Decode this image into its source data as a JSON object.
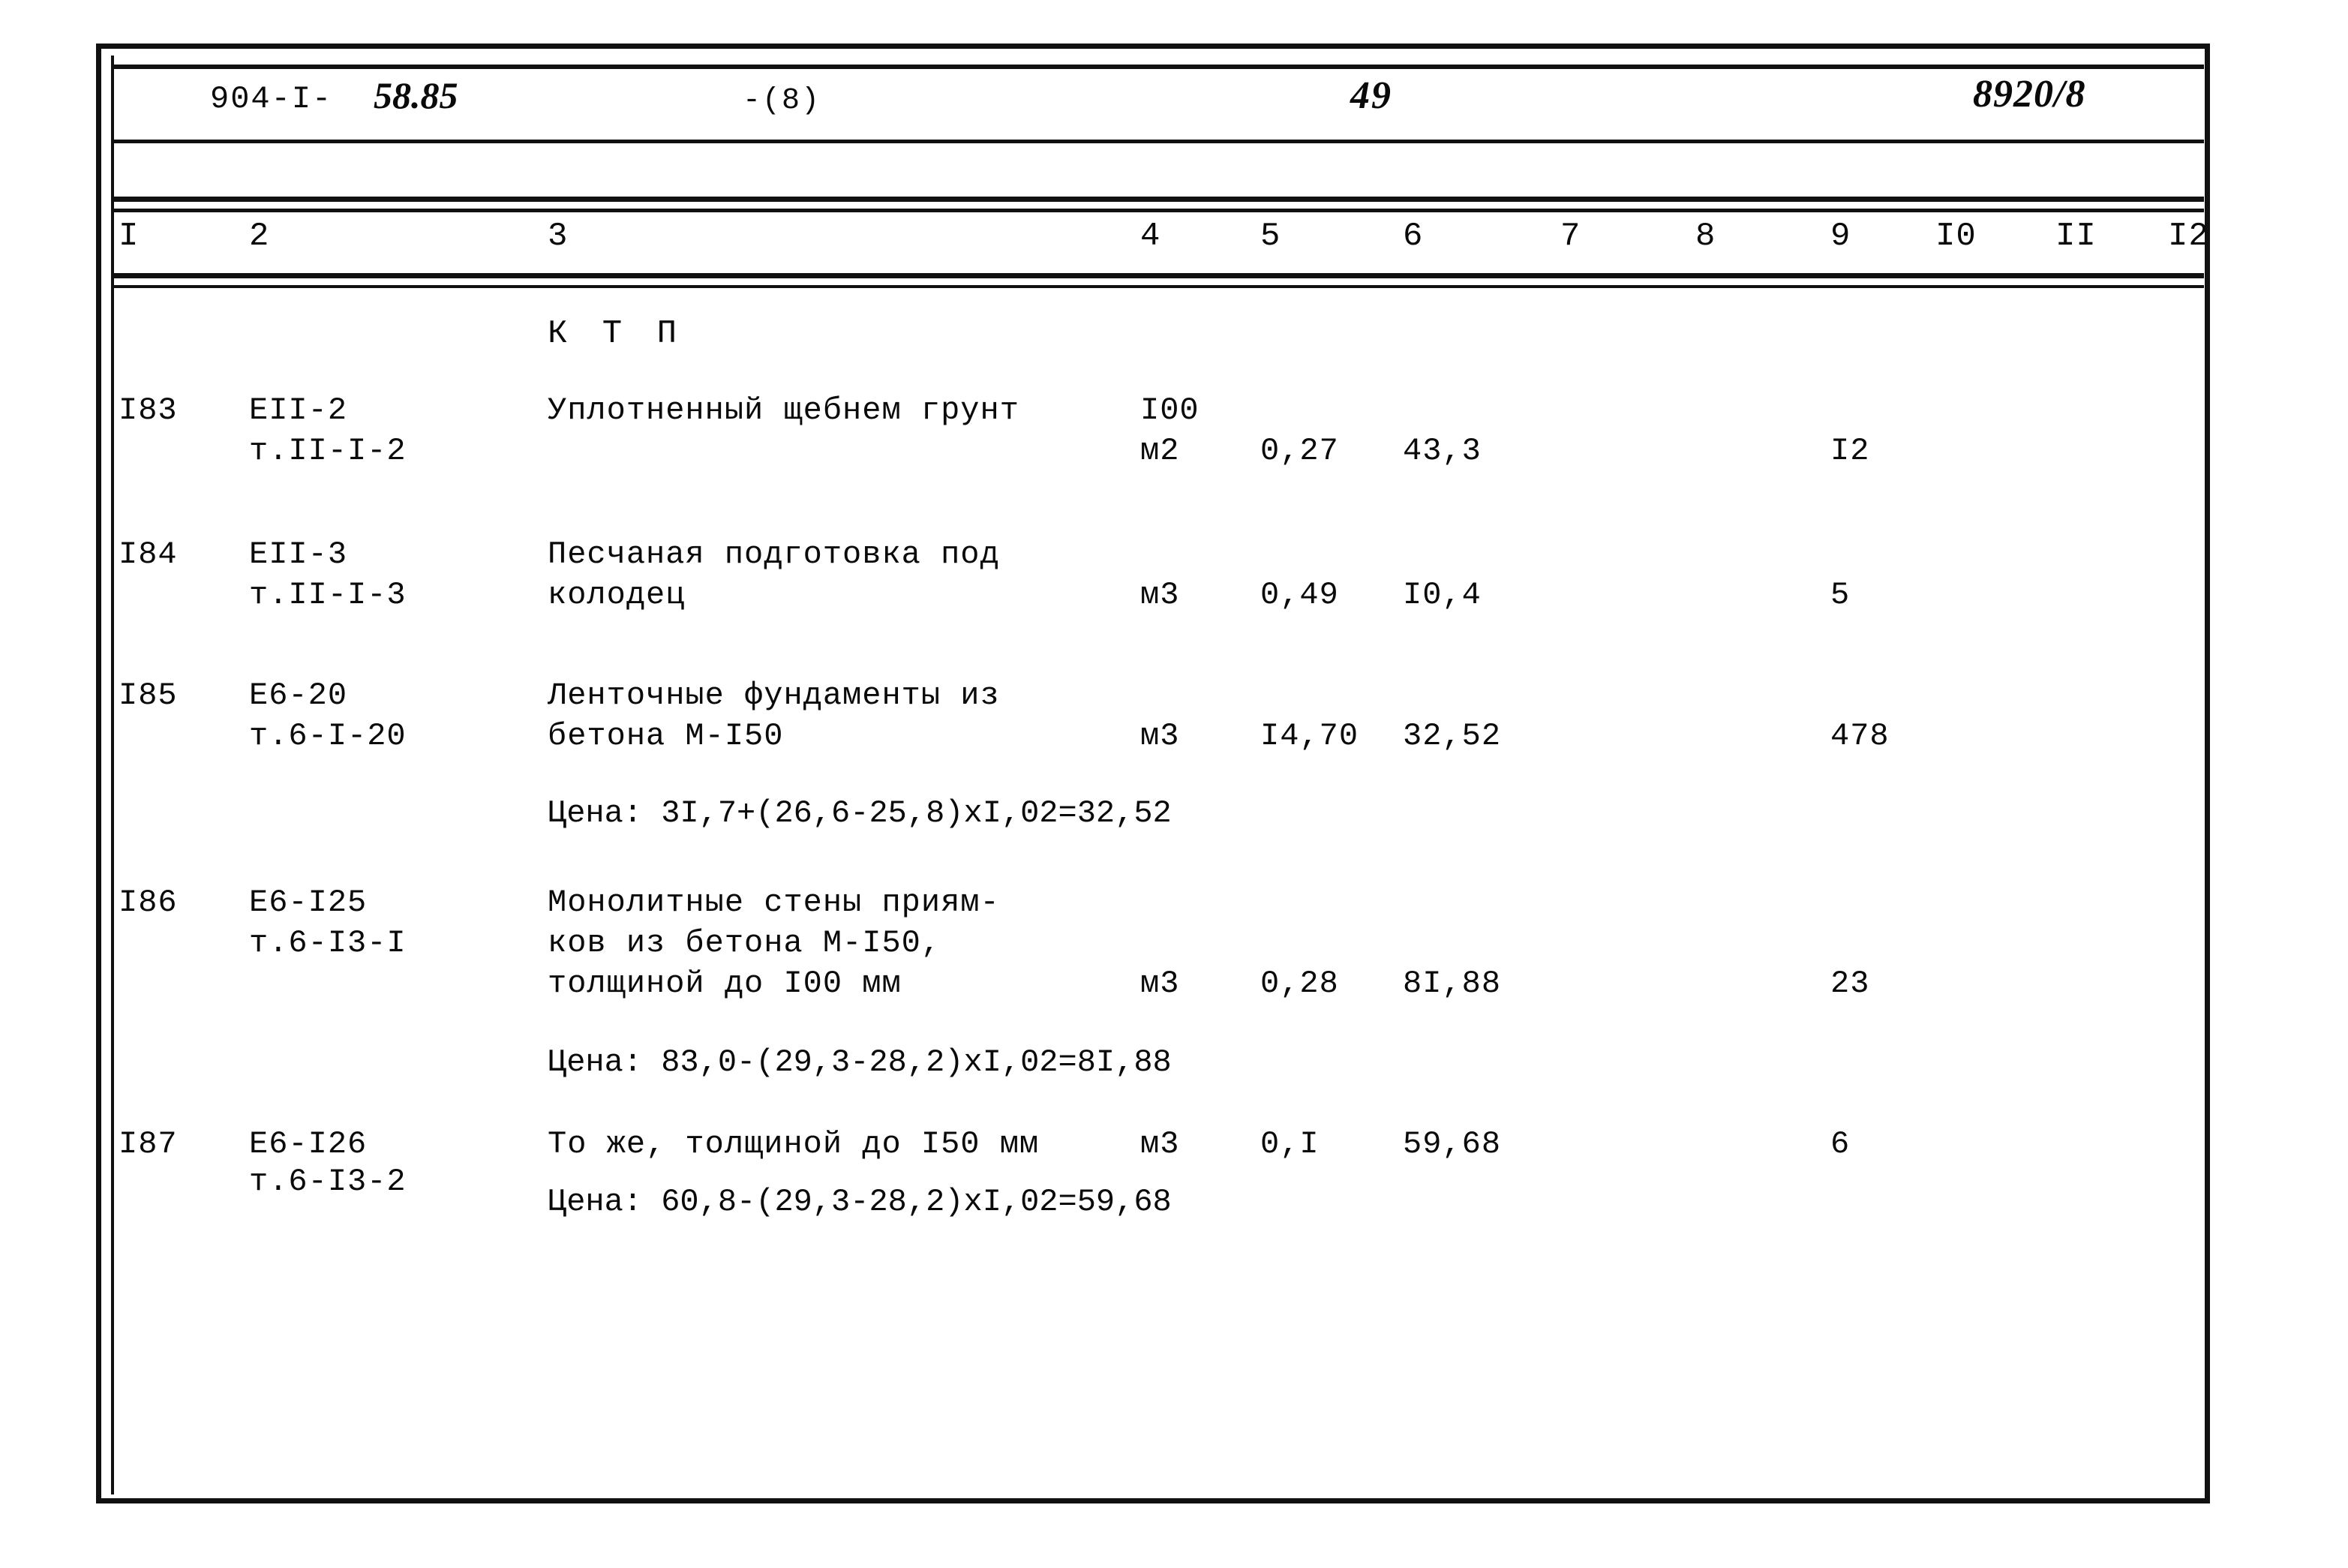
{
  "document": {
    "header": {
      "code_base": "904-I-",
      "code_handwritten": "58.85",
      "sheet_label": "-(8)",
      "page_number": "49",
      "stamp": "8920/8"
    },
    "column_headers": [
      "I",
      "2",
      "3",
      "4",
      "5",
      "6",
      "7",
      "8",
      "9",
      "I0",
      "II",
      "I2"
    ],
    "section_title": "К Т П",
    "rows": [
      {
        "no": "I83",
        "code": "EII-2",
        "code_ref": "т.II-I-2",
        "description": [
          "Уплотненный щебнем грунт"
        ],
        "unit_top": "I00",
        "unit": "м2",
        "col5": "0,27",
        "col6": "43,3",
        "col7": "",
        "col8": "",
        "col9": "I2",
        "col10": "",
        "col11": "",
        "col12": "",
        "price": ""
      },
      {
        "no": "I84",
        "code": "EII-3",
        "code_ref": "т.II-I-3",
        "description": [
          "Песчаная подготовка под",
          "колодец"
        ],
        "unit_top": "",
        "unit": "м3",
        "col5": "0,49",
        "col6": "I0,4",
        "col7": "",
        "col8": "",
        "col9": "5",
        "col10": "",
        "col11": "",
        "col12": "",
        "price": ""
      },
      {
        "no": "I85",
        "code": "E6-20",
        "code_ref": "т.6-I-20",
        "description": [
          "Ленточные фундаменты из",
          "бетона М-I50"
        ],
        "unit_top": "",
        "unit": "м3",
        "col5": "I4,70",
        "col6": "32,52",
        "col7": "",
        "col8": "",
        "col9": "478",
        "col10": "",
        "col11": "",
        "col12": "",
        "price": "Цена: 3I,7+(26,6-25,8)xI,02=32,52"
      },
      {
        "no": "I86",
        "code": "E6-I25",
        "code_ref": "т.6-I3-I",
        "description": [
          "Монолитные стены приям-",
          "ков из бетона М-I50,",
          "толщиной до I00 мм"
        ],
        "unit_top": "",
        "unit": "м3",
        "col5": "0,28",
        "col6": "8I,88",
        "col7": "",
        "col8": "",
        "col9": "23",
        "col10": "",
        "col11": "",
        "col12": "",
        "price": "Цена: 83,0-(29,3-28,2)xI,02=8I,88"
      },
      {
        "no": "I87",
        "code": "E6-I26",
        "code_ref": "т.6-I3-2",
        "description": [
          "То же, толщиной до I50 мм"
        ],
        "unit_top": "",
        "unit": "м3",
        "col5": "0,I",
        "col6": "59,68",
        "col7": "",
        "col8": "",
        "col9": "6",
        "col10": "",
        "col11": "",
        "col12": "",
        "price": "Цена: 60,8-(29,3-28,2)xI,02=59,68"
      }
    ]
  }
}
